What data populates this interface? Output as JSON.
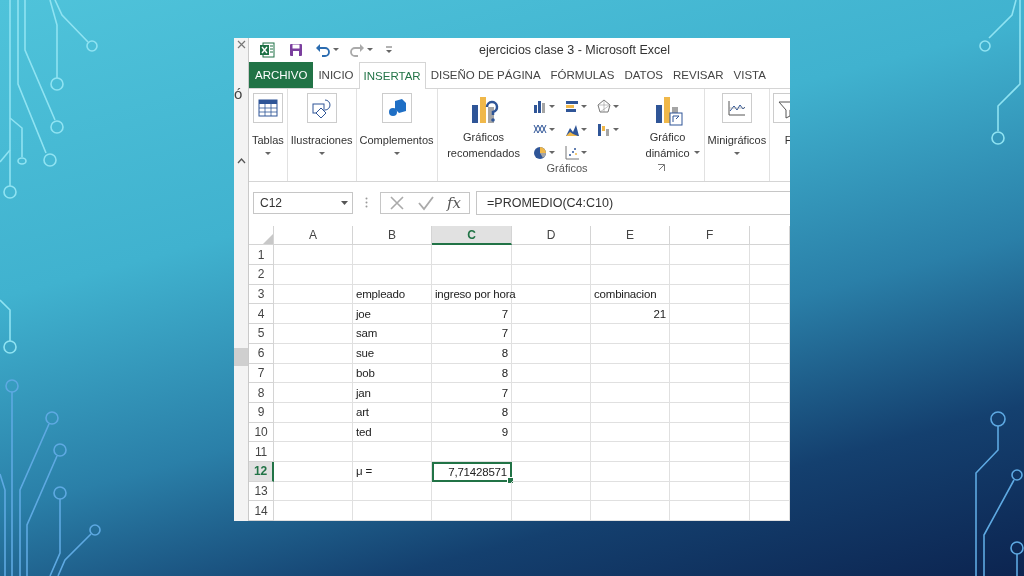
{
  "background_window": {
    "text": "ó"
  },
  "window": {
    "title": "ejercicios clase 3 - Microsoft Excel"
  },
  "tabs": [
    {
      "label": "ARCHIVO",
      "kind": "file",
      "selected": false
    },
    {
      "label": "INICIO",
      "kind": "tab",
      "selected": false
    },
    {
      "label": "INSERTAR",
      "kind": "tab",
      "selected": true
    },
    {
      "label": "DISEÑO DE PÁGINA",
      "kind": "tab",
      "selected": false
    },
    {
      "label": "FÓRMULAS",
      "kind": "tab",
      "selected": false
    },
    {
      "label": "DATOS",
      "kind": "tab",
      "selected": false
    },
    {
      "label": "REVISAR",
      "kind": "tab",
      "selected": false
    },
    {
      "label": "VISTA",
      "kind": "tab",
      "selected": false
    }
  ],
  "ribbon": {
    "groups": [
      {
        "kind": "single",
        "buttons": [
          {
            "kind": "table",
            "label": "Tablas",
            "dropdown": true
          }
        ]
      },
      {
        "kind": "single",
        "buttons": [
          {
            "kind": "shapes",
            "label": "Ilustraciones",
            "dropdown": true
          }
        ]
      },
      {
        "kind": "single",
        "buttons": [
          {
            "kind": "addin",
            "label": "Complementos",
            "dropdown": true
          }
        ]
      },
      {
        "kind": "charts",
        "label": "Gráficos",
        "buttons": [
          {
            "kind": "recommended",
            "label": "Gráficos recomendados",
            "dropdown": false
          },
          {
            "kind": "gallery"
          },
          {
            "kind": "pivot",
            "label": "Gráfico dinámico",
            "dropdown": true
          }
        ]
      },
      {
        "kind": "single",
        "buttons": [
          {
            "kind": "sparkline",
            "label": "Minigráficos",
            "dropdown": true
          }
        ]
      },
      {
        "kind": "cut",
        "buttons": [
          {
            "kind": "filter",
            "label": "F",
            "dropdown": false
          }
        ]
      }
    ]
  },
  "formula_bar": {
    "name_box": "C12",
    "function_label": "fx",
    "formula": "=PROMEDIO(C4:C10)"
  },
  "sheet": {
    "columns": [
      {
        "label": "A",
        "selected": false
      },
      {
        "label": "B",
        "selected": false
      },
      {
        "label": "C",
        "selected": true
      },
      {
        "label": "D",
        "selected": false
      },
      {
        "label": "E",
        "selected": false
      },
      {
        "label": "F",
        "selected": false
      }
    ],
    "rows": [
      {
        "number": "1",
        "selected": false,
        "cells": {}
      },
      {
        "number": "2",
        "selected": false,
        "cells": {}
      },
      {
        "number": "3",
        "selected": false,
        "cells": {
          "B": {
            "kind": "text",
            "text": "empleado",
            "selected": false
          },
          "C": {
            "kind": "text",
            "text": "ingreso por hora",
            "selected": false
          },
          "E": {
            "kind": "text",
            "text": "combinacion",
            "selected": false
          }
        }
      },
      {
        "number": "4",
        "selected": false,
        "cells": {
          "B": {
            "kind": "text",
            "text": "joe",
            "selected": false
          },
          "C": {
            "kind": "number",
            "text": "7",
            "selected": false
          },
          "E": {
            "kind": "number",
            "text": "21",
            "selected": false
          }
        }
      },
      {
        "number": "5",
        "selected": false,
        "cells": {
          "B": {
            "kind": "text",
            "text": "sam",
            "selected": false
          },
          "C": {
            "kind": "number",
            "text": "7",
            "selected": false
          }
        }
      },
      {
        "number": "6",
        "selected": false,
        "cells": {
          "B": {
            "kind": "text",
            "text": "sue",
            "selected": false
          },
          "C": {
            "kind": "number",
            "text": "8",
            "selected": false
          }
        }
      },
      {
        "number": "7",
        "selected": false,
        "cells": {
          "B": {
            "kind": "text",
            "text": "bob",
            "selected": false
          },
          "C": {
            "kind": "number",
            "text": "8",
            "selected": false
          }
        }
      },
      {
        "number": "8",
        "selected": false,
        "cells": {
          "B": {
            "kind": "text",
            "text": "jan",
            "selected": false
          },
          "C": {
            "kind": "number",
            "text": "7",
            "selected": false
          }
        }
      },
      {
        "number": "9",
        "selected": false,
        "cells": {
          "B": {
            "kind": "text",
            "text": "art",
            "selected": false
          },
          "C": {
            "kind": "number",
            "text": "8",
            "selected": false
          }
        }
      },
      {
        "number": "10",
        "selected": false,
        "cells": {
          "B": {
            "kind": "text",
            "text": "ted",
            "selected": false
          },
          "C": {
            "kind": "number",
            "text": "9",
            "selected": false
          }
        }
      },
      {
        "number": "11",
        "selected": false,
        "cells": {}
      },
      {
        "number": "12",
        "selected": true,
        "cells": {
          "B": {
            "kind": "text",
            "text": "μ =",
            "selected": false
          },
          "C": {
            "kind": "number",
            "text": "7,71428571",
            "selected": true
          }
        }
      },
      {
        "number": "13",
        "selected": false,
        "cells": {}
      },
      {
        "number": "14",
        "selected": false,
        "cells": {}
      }
    ]
  }
}
